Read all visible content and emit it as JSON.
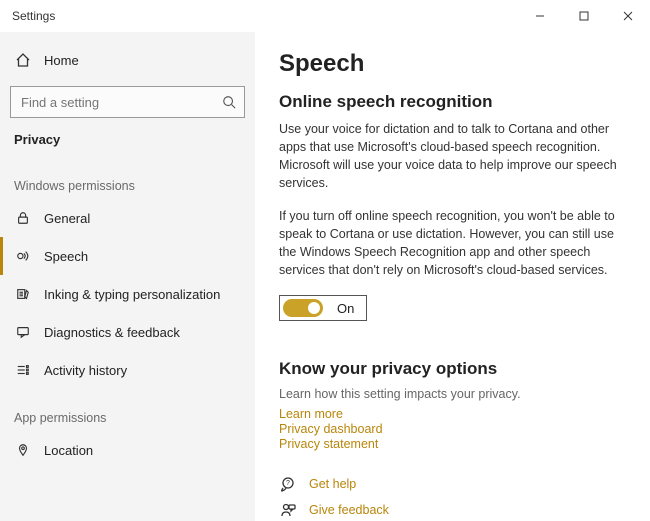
{
  "window": {
    "title": "Settings"
  },
  "sidebar": {
    "home": "Home",
    "search_placeholder": "Find a setting",
    "category": "Privacy",
    "group_windows": "Windows permissions",
    "group_app": "App permissions",
    "items": {
      "general": "General",
      "speech": "Speech",
      "inking": "Inking & typing personalization",
      "diag": "Diagnostics & feedback",
      "activity": "Activity history",
      "location": "Location"
    }
  },
  "content": {
    "heading": "Speech",
    "section1_title": "Online speech recognition",
    "section1_p1": "Use your voice for dictation and to talk to Cortana and other apps that use Microsoft's cloud-based speech recognition. Microsoft will use your voice data to help improve our speech services.",
    "section1_p2": "If you turn off online speech recognition, you won't be able to speak to Cortana or use dictation. However, you can still use the Windows Speech Recognition app and other speech services that don't rely on Microsoft's cloud-based services.",
    "toggle_state": "On",
    "section2_title": "Know your privacy options",
    "section2_hint": "Learn how this setting impacts your privacy.",
    "links": {
      "learn_more": "Learn more",
      "dashboard": "Privacy dashboard",
      "statement": "Privacy statement",
      "get_help": "Get help",
      "feedback": "Give feedback"
    }
  }
}
